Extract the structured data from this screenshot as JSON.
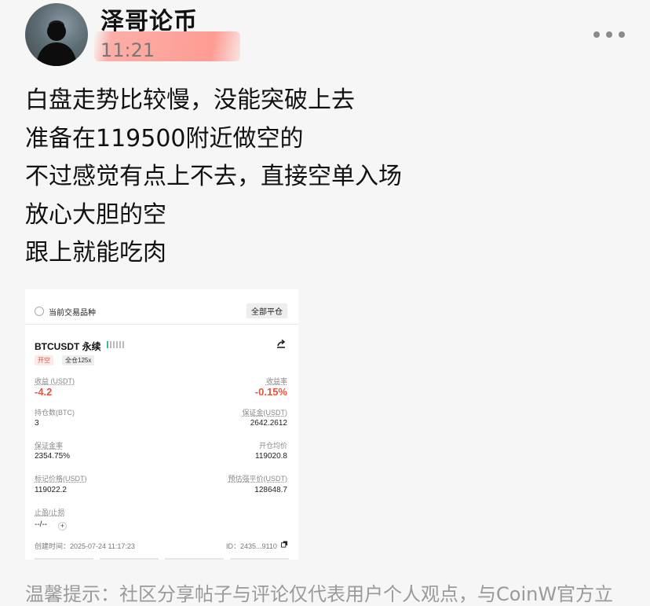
{
  "header": {
    "author": "泽哥论币",
    "time": "11:21"
  },
  "post": {
    "lines": [
      "白盘走势比较慢，没能突破上去",
      "准备在119500附近做空的",
      "不过感觉有点上不去，直接空单入场",
      "放心大胆的空",
      "跟上就能吃肉"
    ]
  },
  "card": {
    "header_label": "当前交易品种",
    "close_all": "全部平仓",
    "symbol": "BTCUSDT 永续",
    "tag_side": "开空",
    "tag_margin": "全仓125x",
    "pnl_label": "收益 (USDT)",
    "pnl_value": "-4.2",
    "roe_label": "收益率",
    "roe_value": "-0.15%",
    "size_label": "持仓数(BTC)",
    "size_value": "3",
    "margin_label": "保证金(USDT)",
    "margin_value": "2642.2612",
    "margin_rate_label": "保证金率",
    "margin_rate_value": "2354.75%",
    "entry_label": "开仓均价",
    "entry_value": "119020.8",
    "mark_label": "标记价格(USDT)",
    "mark_value": "119022.2",
    "liq_label": "预估强平价(USDT)",
    "liq_value": "128648.7",
    "tpsl_label": "止盈/止损",
    "tpsl_value": "--/--",
    "tpsl_add": "+",
    "created": "创建时间：2025-07-24 11:17:23",
    "id": "ID：2435...9110"
  },
  "footer": {
    "disclaimer": "温馨提示：社区分享帖子与评论仅代表用户个人观点，与CoinW官方立"
  },
  "colors": {
    "loss": "#e0553f",
    "highlight": "#ff8c82"
  }
}
